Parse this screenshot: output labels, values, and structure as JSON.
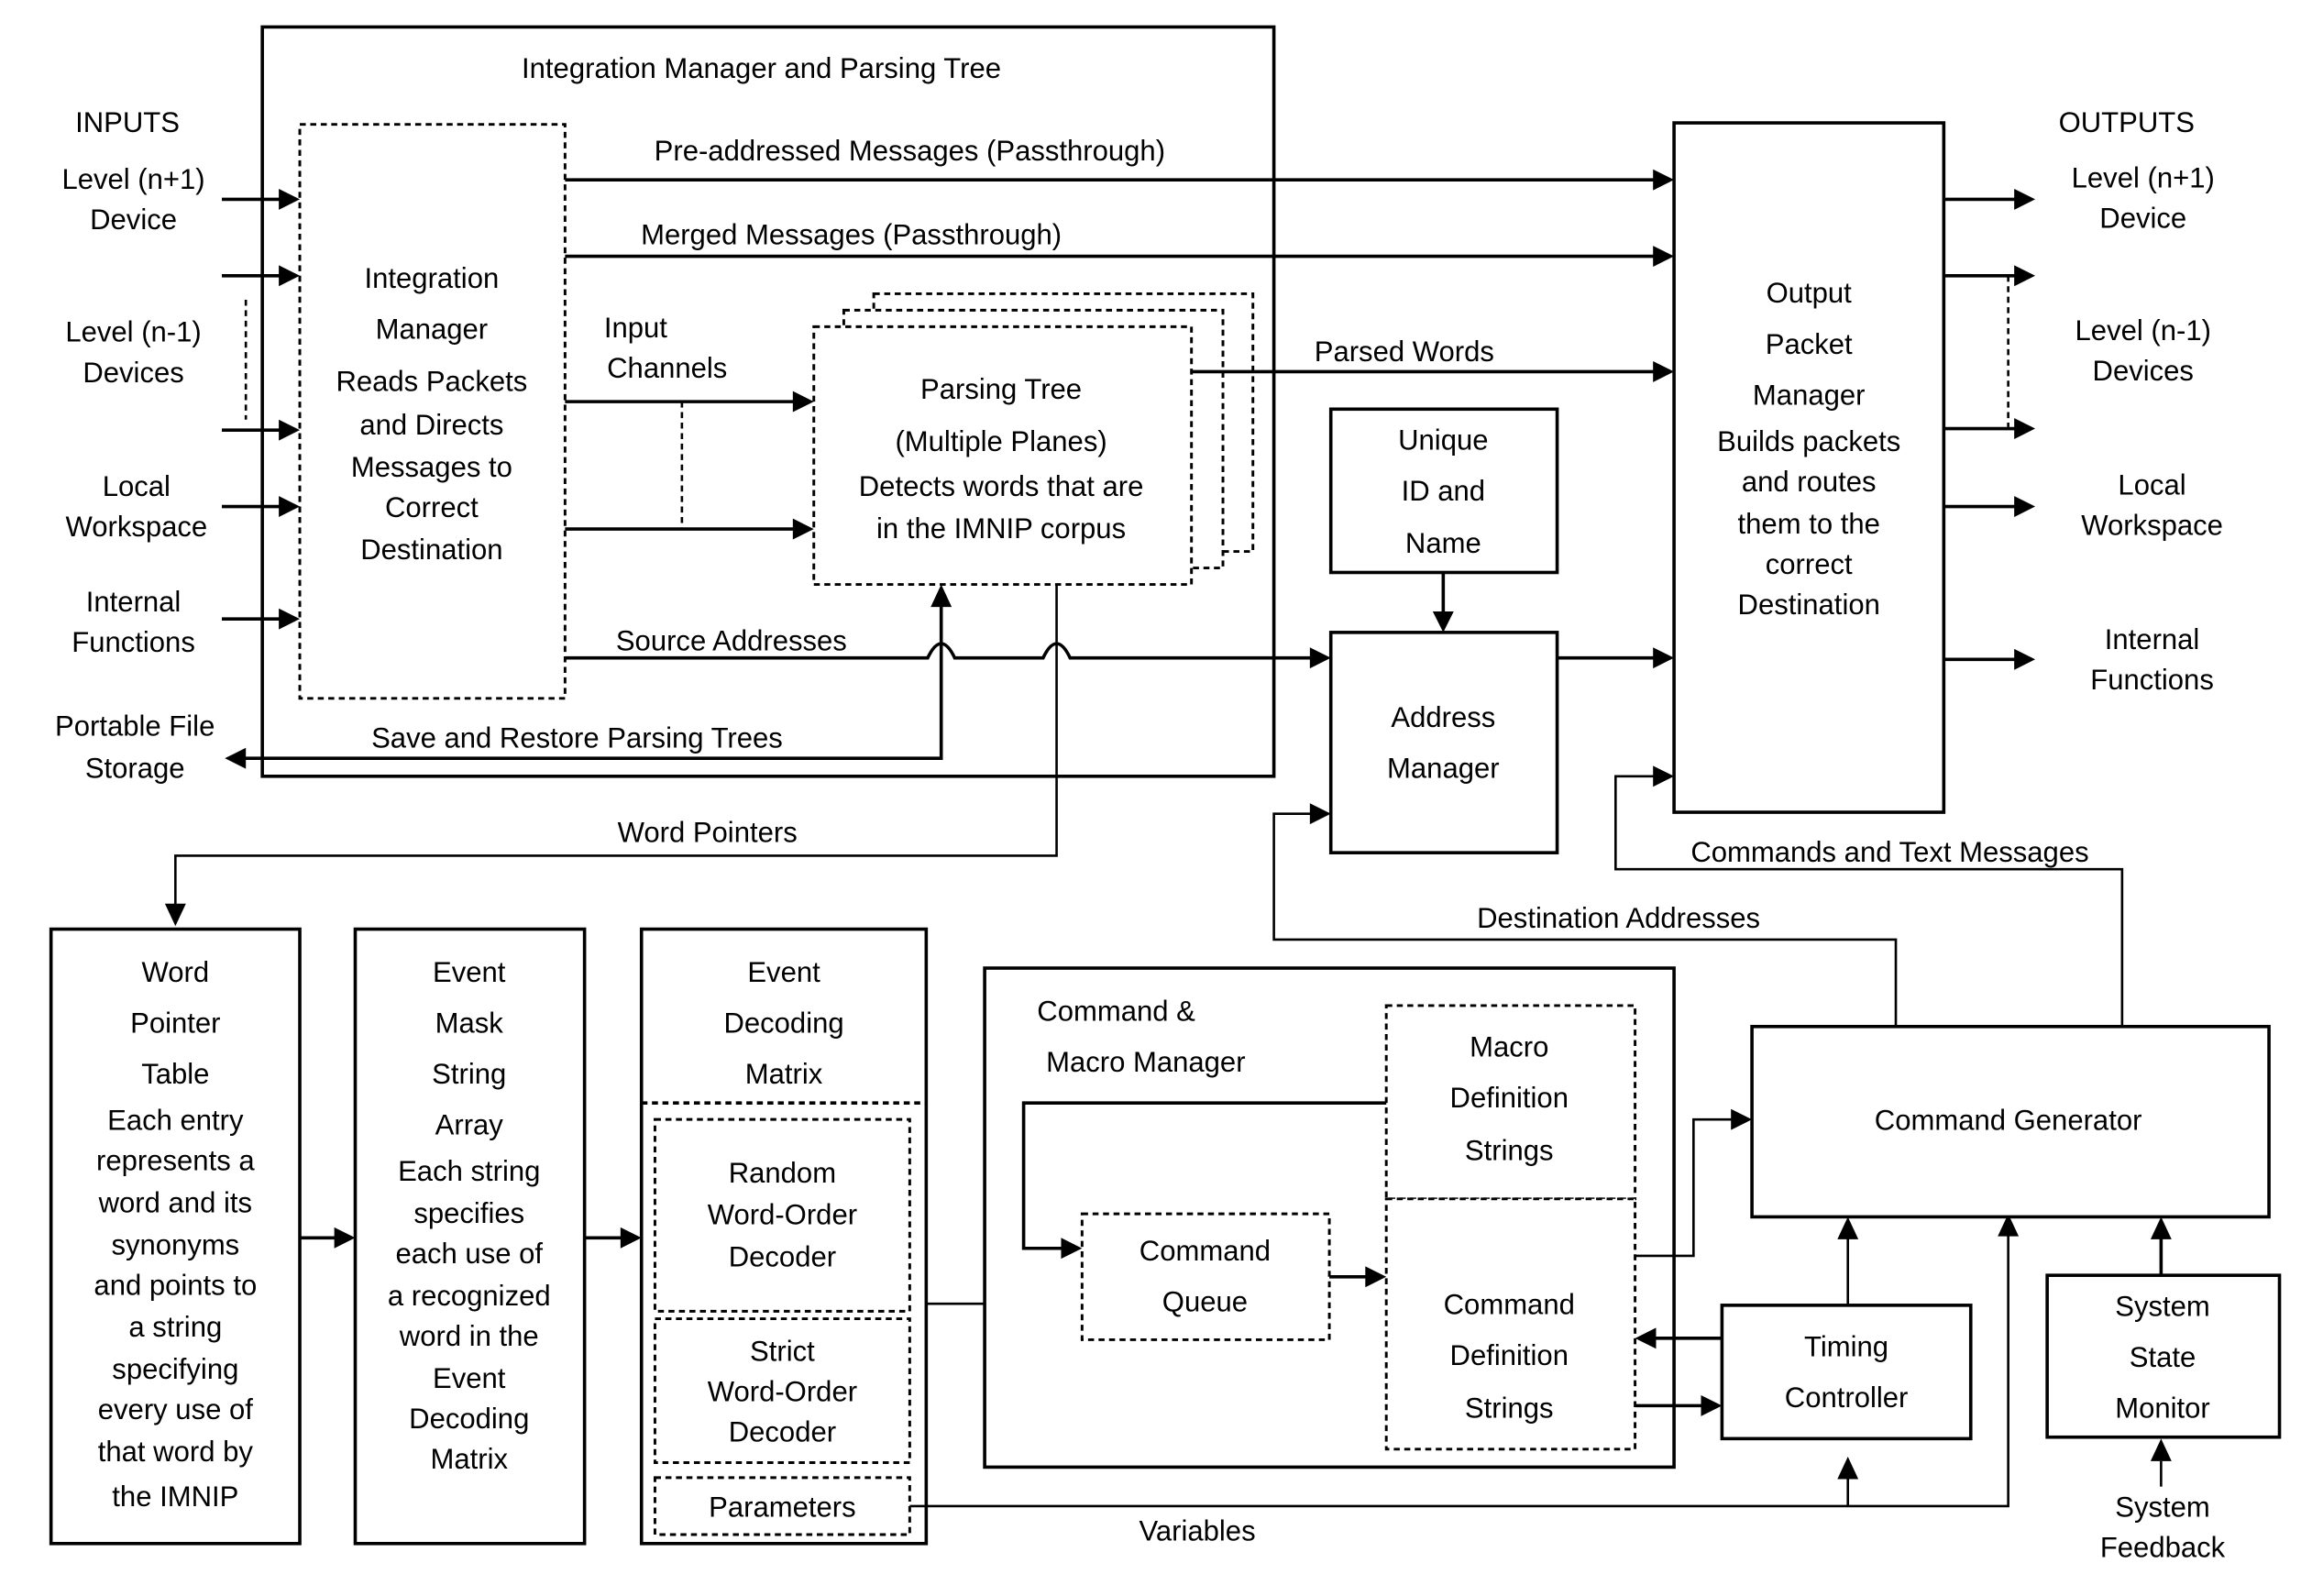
{
  "inputs": {
    "title": "INPUTS",
    "items": [
      [
        "Level (n+1)",
        "Device"
      ],
      [
        "Level (n-1)",
        "Devices"
      ],
      [
        "Local",
        "Workspace"
      ],
      [
        "Internal",
        "Functions"
      ]
    ],
    "storage": [
      "Portable File",
      "Storage"
    ]
  },
  "outputs": {
    "title": "OUTPUTS",
    "items": [
      [
        "Level (n+1)",
        "Device"
      ],
      [
        "Level (n-1)",
        "Devices"
      ],
      [
        "Local",
        "Workspace"
      ],
      [
        "Internal",
        "Functions"
      ]
    ]
  },
  "integration": {
    "title": "Integration Manager and Parsing Tree",
    "manager": [
      "Integration",
      "Manager",
      "Reads Packets",
      "and Directs",
      "Messages to",
      "Correct",
      "Destination"
    ],
    "input_channels": [
      "Input",
      "Channels"
    ],
    "parsing_tree": [
      "Parsing Tree",
      "(Multiple Planes)",
      "Detects words that are",
      "in the IMNIP corpus"
    ]
  },
  "flows": {
    "pre_addressed": "Pre-addressed Messages (Passthrough)",
    "merged": "Merged Messages (Passthrough)",
    "parsed_words": "Parsed Words",
    "source_addresses": "Source Addresses",
    "save_restore": "Save and Restore Parsing Trees",
    "word_pointers": "Word Pointers",
    "commands_text": "Commands and Text Messages",
    "destination_addresses": "Destination Addresses",
    "variables": "Variables"
  },
  "unique_id": [
    "Unique",
    "ID and",
    "Name"
  ],
  "address_manager": [
    "Address",
    "Manager"
  ],
  "output_packet_manager": [
    "Output",
    "Packet",
    "Manager",
    "Builds packets",
    "and routes",
    "them to the",
    "correct",
    "Destination"
  ],
  "word_pointer_table": [
    "Word",
    "Pointer",
    "Table",
    "Each entry",
    "represents a",
    "word and its",
    "synonyms",
    "and points to",
    "a string",
    "specifying",
    "every use of",
    "that word by",
    "the IMNIP"
  ],
  "event_mask": [
    "Event",
    "Mask",
    "String",
    "Array",
    "Each string",
    "specifies",
    "each use of",
    "a recognized",
    "word in the",
    "Event",
    "Decoding",
    "Matrix"
  ],
  "event_decoding": {
    "title": [
      "Event",
      "Decoding",
      "Matrix"
    ],
    "random": [
      "Random",
      "Word-Order",
      "Decoder"
    ],
    "strict": [
      "Strict",
      "Word-Order",
      "Decoder"
    ],
    "parameters": "Parameters"
  },
  "command_macro": {
    "title": [
      "Command &",
      "Macro Manager"
    ],
    "queue": [
      "Command",
      "Queue"
    ],
    "macro_defs": [
      "Macro",
      "Definition",
      "Strings"
    ],
    "command_defs": [
      "Command",
      "Definition",
      "Strings"
    ]
  },
  "command_generator": "Command Generator",
  "timing_controller": [
    "Timing",
    "Controller"
  ],
  "system_state_monitor": [
    "System",
    "State",
    "Monitor"
  ],
  "system_feedback": [
    "System",
    "Feedback"
  ]
}
